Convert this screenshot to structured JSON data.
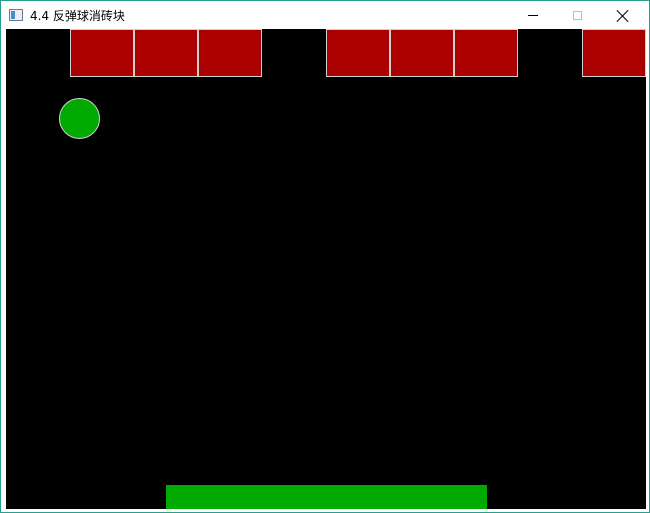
{
  "window": {
    "title": "4.4 反弹球消砖块",
    "border_color": "#2a9d8f",
    "icons": {
      "app": "app-window-icon",
      "minimize": "minimize-icon",
      "maximize": "maximize-icon",
      "close": "close-icon"
    },
    "maximize_enabled": false
  },
  "game": {
    "background_color": "#000000",
    "brick_color": "#aa0000",
    "brick_border_color": "#d0d0d0",
    "ball_color": "#00aa00",
    "paddle_color": "#00aa00",
    "bricks_visible": [
      false,
      true,
      true,
      true,
      false,
      true,
      true,
      true,
      false,
      true
    ]
  }
}
